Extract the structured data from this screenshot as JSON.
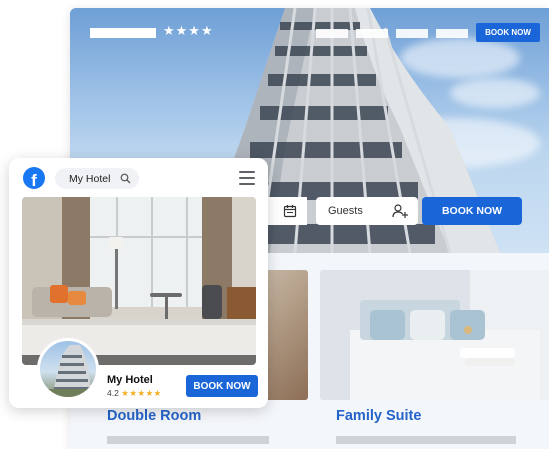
{
  "website": {
    "hero": {
      "rating_stars": "★★★★",
      "book_label": "BOOK NOW"
    },
    "search": {
      "date_icon": "calendar-icon",
      "guests_label": "Guests",
      "guests_icon": "add-person-icon",
      "book_label": "BOOK NOW"
    },
    "rooms": [
      {
        "title": "Double Room"
      },
      {
        "title": "Family Suite"
      }
    ]
  },
  "mobile": {
    "logo_icon": "facebook-icon",
    "logo_letter": "f",
    "search_text": "My Hotel",
    "search_icon": "search-icon",
    "menu_icon": "hamburger-menu-icon",
    "hotel_name": "My Hotel",
    "rating": "4.2",
    "rating_stars": "★★★★★",
    "book_label": "BOOK NOW"
  },
  "colors": {
    "accent": "#1a66d9",
    "title": "#2563c9",
    "star": "#f2b01e",
    "facebook": "#1877f2"
  }
}
